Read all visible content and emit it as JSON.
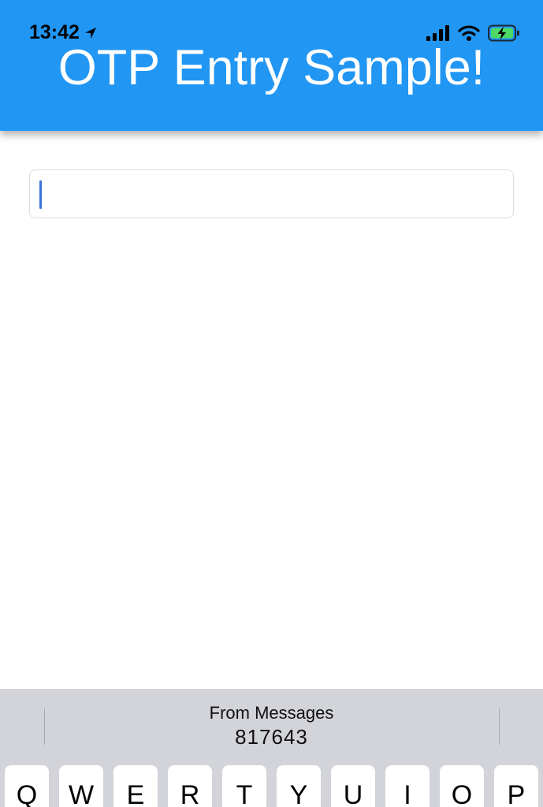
{
  "status_bar": {
    "time": "13:42",
    "icons": [
      "location-arrow-icon",
      "signal-icon",
      "wifi-icon",
      "battery-charging-icon"
    ]
  },
  "header": {
    "title": "OTP Entry Sample!",
    "background_color": "#2196f3"
  },
  "otp_input": {
    "value": "",
    "caret_color": "#3b73e0"
  },
  "quicktype": {
    "caption": "From Messages",
    "code": "817643"
  },
  "keyboard": {
    "row1": [
      "Q",
      "W",
      "E",
      "R",
      "T",
      "Y",
      "U",
      "I",
      "O",
      "P"
    ]
  }
}
